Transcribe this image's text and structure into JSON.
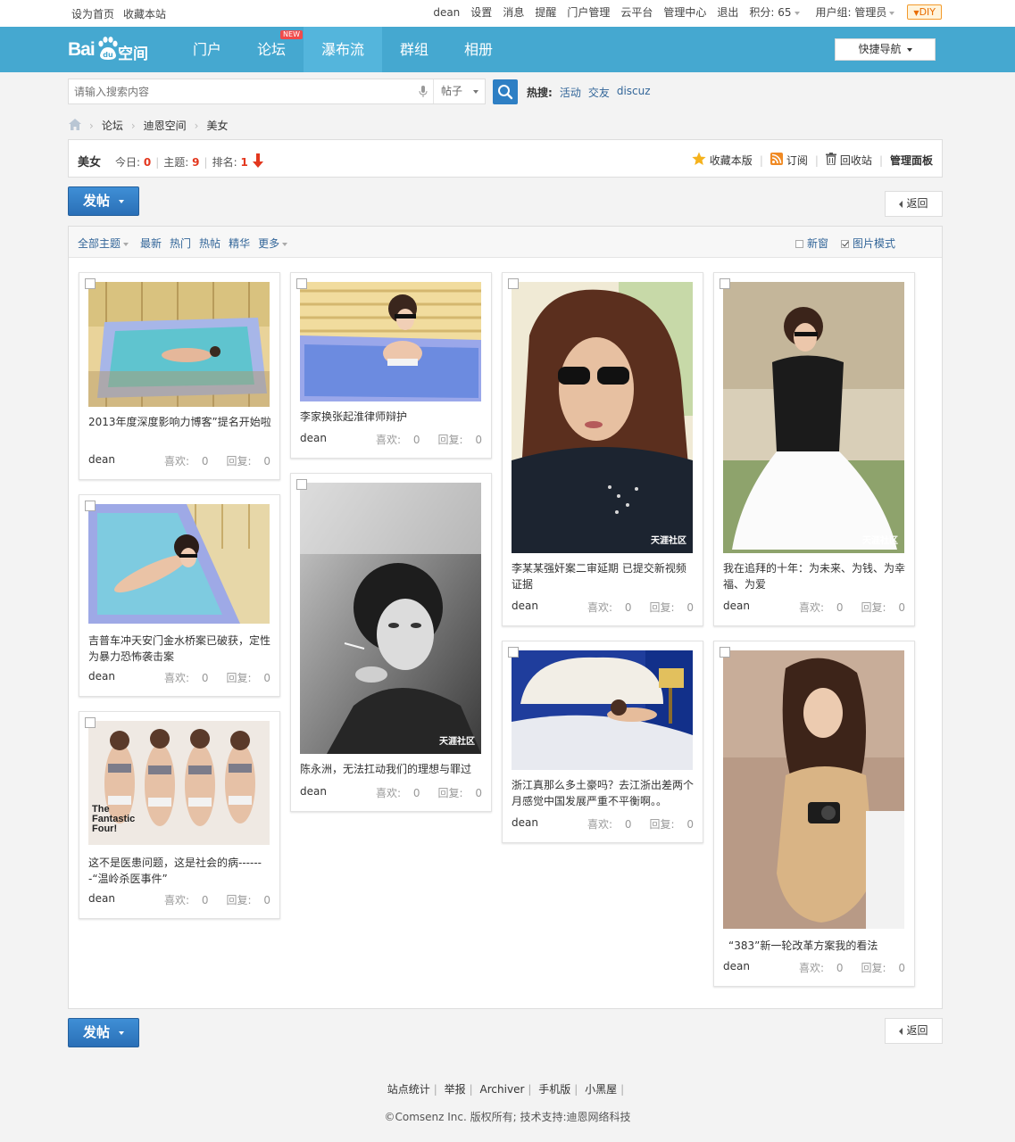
{
  "topbar": {
    "left": [
      "设为首页",
      "收藏本站"
    ],
    "right": [
      "dean",
      "设置",
      "消息",
      "提醒",
      "门户管理",
      "云平台",
      "管理中心",
      "退出"
    ],
    "credits": "积分: 65",
    "usergroup": "用户组: 管理员",
    "diy": "DIY"
  },
  "nav": {
    "logo_text": "Bai",
    "logo_paw_text": "du",
    "logo_suffix": "空间",
    "items": [
      "门户",
      "论坛",
      "瀑布流",
      "群组",
      "相册"
    ],
    "new_badge": "NEW",
    "quick_nav": "快捷导航"
  },
  "search": {
    "placeholder": "请输入搜索内容",
    "type": "帖子",
    "hot_label": "热搜:",
    "hot_keywords": [
      "活动",
      "交友",
      "discuz"
    ]
  },
  "breadcrumb": [
    "论坛",
    "迪恩空间",
    "美女"
  ],
  "forum": {
    "name": "美女",
    "today_label": "今日:",
    "today": "0",
    "topics_label": "主题:",
    "topics": "9",
    "rank_label": "排名:",
    "rank": "1",
    "actions": [
      "收藏本版",
      "订阅",
      "回收站",
      "管理面板"
    ]
  },
  "buttons": {
    "post": "发帖",
    "back": "返回"
  },
  "filters": {
    "all": "全部主题",
    "items": [
      "最新",
      "热门",
      "热帖",
      "精华"
    ],
    "more": "更多",
    "new_window": "新窗",
    "image_mode": "图片模式"
  },
  "meta_labels": {
    "likes": "喜欢:",
    "replies": "回复:"
  },
  "posts": [
    {
      "title": "2013年度深度影响力博客”提名开始啦",
      "author": "dean",
      "likes": "0",
      "replies": "0"
    },
    {
      "title": "吉普车冲天安门金水桥案已破获，定性为暴力恐怖袭击案",
      "author": "dean",
      "likes": "0",
      "replies": "0"
    },
    {
      "title": "这不是医患问题，这是社会的病-------“温岭杀医事件”",
      "author": "dean",
      "likes": "0",
      "replies": "0",
      "image_text": "The Fantastic Four!"
    },
    {
      "title": "李家换张起淮律师辩护",
      "author": "dean",
      "likes": "0",
      "replies": "0"
    },
    {
      "title": "陈永洲，无法扛动我们的理想与罪过",
      "author": "dean",
      "likes": "0",
      "replies": "0",
      "watermark": "天涯社区"
    },
    {
      "title": "李某某强奸案二审延期 已提交新视频证据",
      "author": "dean",
      "likes": "0",
      "replies": "0",
      "watermark": "天涯社区"
    },
    {
      "title": "浙江真那么多土豪吗？去江浙出差两个月感觉中国发展严重不平衡啊。。",
      "author": "dean",
      "likes": "0",
      "replies": "0"
    },
    {
      "title": "我在追拜的十年：为未来、为钱、为幸福、为爱",
      "author": "dean",
      "likes": "0",
      "replies": "0",
      "watermark": "天涯社区"
    },
    {
      "title": "“383”新一轮改革方案我的看法",
      "author": "dean",
      "likes": "0",
      "replies": "0"
    }
  ],
  "footer": {
    "links": [
      "站点统计",
      "举报",
      "Archiver",
      "手机版",
      "小黑屋"
    ],
    "copyright": "©Comsenz Inc. 版权所有;   技术支持:迪恩网络科技"
  },
  "colors": {
    "nav_bg": "#45a8d0",
    "nav_active": "#54b5dc",
    "post_button": "#2f7cc7",
    "link": "#336699",
    "stat_red": "#e3371e"
  }
}
